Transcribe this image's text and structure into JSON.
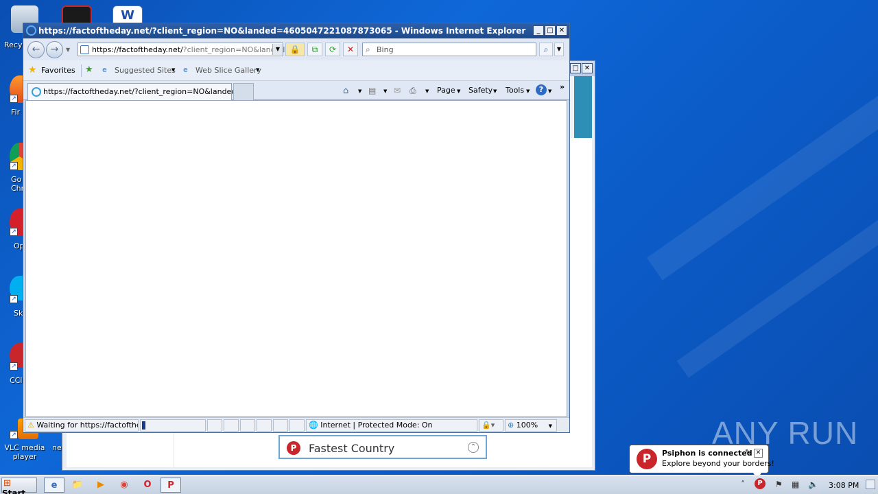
{
  "desktop": {
    "icons": [
      {
        "label": "Recy"
      },
      {
        "label": "Fir"
      },
      {
        "label": "Go Chr"
      },
      {
        "label": "Op"
      },
      {
        "label": "Sk"
      },
      {
        "label": "CCl"
      },
      {
        "label": "VLC media player"
      },
      {
        "label": "ne"
      }
    ]
  },
  "ie": {
    "title": "https://factoftheday.net/?client_region=NO&landed=4605047221087873065 - Windows Internet Explorer",
    "address_main": "https://factoftheday.net/",
    "address_rest": "?client_region=NO&landed=",
    "search_placeholder": "Bing",
    "favorites": {
      "label": "Favorites",
      "suggested": "Suggested Sites",
      "webslice": "Web Slice Gallery"
    },
    "tab_title": "https://factoftheday.net/?client_region=NO&landed...",
    "commands": {
      "page": "Page",
      "safety": "Safety",
      "tools": "Tools"
    },
    "status": {
      "text": "Waiting for https://factofthec",
      "zone": "Internet | Protected Mode: On",
      "zoom": "100%"
    }
  },
  "psiphon": {
    "fastest_country": "Fastest Country"
  },
  "notification": {
    "title": "Psiphon is connected",
    "message": "Explore beyond your borders!"
  },
  "taskbar": {
    "start": "Start",
    "clock": "3:08 PM"
  },
  "watermark": "ANY RUN"
}
